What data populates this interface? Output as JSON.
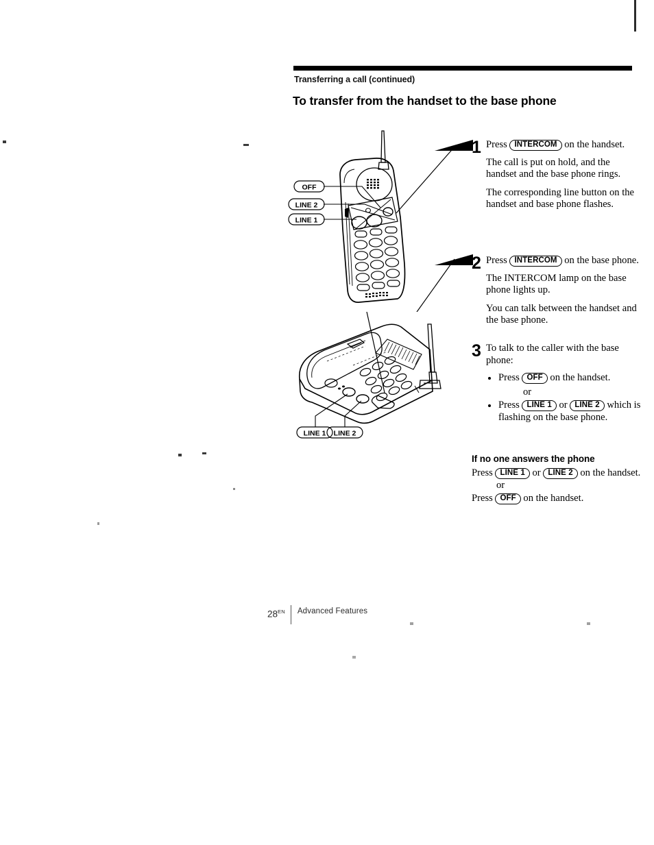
{
  "page": {
    "running_head": "Transferring a call (continued)",
    "section_title": "To transfer from the handset to the base phone"
  },
  "steps": [
    {
      "number": "1",
      "lead_pre": "Press ",
      "lead_key": "INTERCOM",
      "lead_post": " on the handset.",
      "paragraphs": [
        "The call is put on hold, and the handset and the base phone rings.",
        "The corresponding line button on the handset and base phone flashes."
      ]
    },
    {
      "number": "2",
      "lead_pre": "Press ",
      "lead_key": "INTERCOM",
      "lead_post": " on the base phone.",
      "paragraphs": [
        "The INTERCOM lamp on the base phone lights up.",
        "You can talk between the handset and the base phone."
      ]
    },
    {
      "number": "3",
      "lead_text": "To talk to the caller with the base phone:",
      "bullets": [
        {
          "pre": "Press ",
          "key1": "OFF",
          "post": " on the handset."
        },
        {
          "pre": "Press ",
          "key1": "LINE 1",
          "mid": " or ",
          "key2": "LINE 2",
          "post": " which is flashing on the base phone."
        }
      ],
      "or_label": "or"
    }
  ],
  "note": {
    "heading": "If no one answers the phone",
    "line1_pre": "Press ",
    "line1_key1": "LINE 1",
    "line1_mid": " or ",
    "line1_key2": "LINE 2",
    "line1_post": " on the handset.",
    "or_label": "or",
    "line2_pre": "Press ",
    "line2_key": "OFF",
    "line2_post": " on the handset."
  },
  "figures": {
    "handset": {
      "caption_keys": [
        "OFF",
        "LINE 2",
        "LINE 1"
      ]
    },
    "base": {
      "caption_keys": [
        "LINE 1",
        "LINE 2"
      ]
    }
  },
  "footer": {
    "page_number": "28",
    "page_suffix": "EN",
    "chapter": "Advanced Features"
  }
}
